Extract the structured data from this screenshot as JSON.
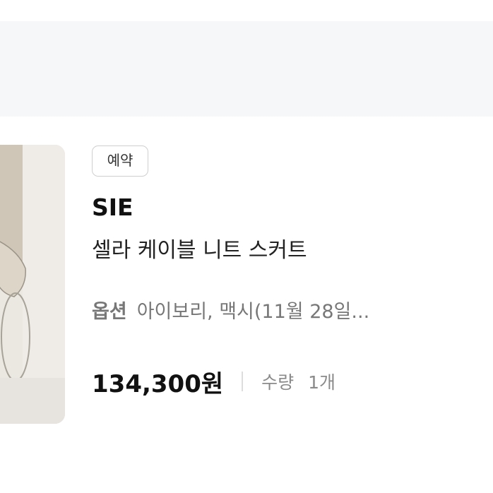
{
  "header": {},
  "product": {
    "badge": "예약",
    "brand": "SIE",
    "name": "셀라 케이블 니트 스커트",
    "option_label": "옵션",
    "option_value": "아이보리, 맥시(11월 28일...",
    "price": "134,300원",
    "quantity_label": "수량",
    "quantity_value": "1개"
  },
  "colors": {
    "page_background": "#ffffff",
    "band_background": "#f6f7f9",
    "text_primary": "#111111",
    "text_secondary": "#777777",
    "badge_border": "#cfcfcf"
  }
}
